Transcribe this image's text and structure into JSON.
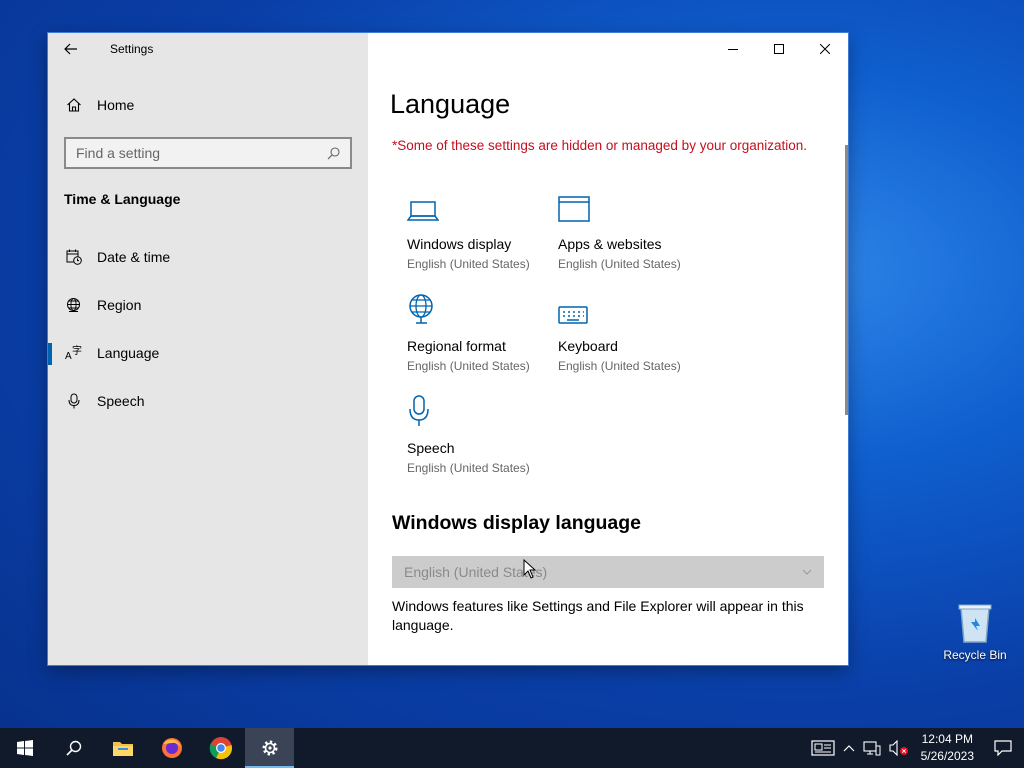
{
  "desktop": {
    "recycle_bin_label": "Recycle Bin"
  },
  "window": {
    "title": "Settings",
    "controls": [
      "minimize",
      "maximize",
      "close"
    ]
  },
  "sidebar": {
    "home_label": "Home",
    "search_placeholder": "Find a setting",
    "section_title": "Time & Language",
    "items": [
      {
        "label": "Date & time",
        "icon": "calendar-clock-icon",
        "active": false
      },
      {
        "label": "Region",
        "icon": "globe-icon",
        "active": false
      },
      {
        "label": "Language",
        "icon": "language-icon",
        "active": true
      },
      {
        "label": "Speech",
        "icon": "microphone-icon",
        "active": false
      }
    ]
  },
  "main": {
    "title": "Language",
    "warning": "*Some of these settings are hidden or managed by your organization.",
    "tiles": [
      {
        "label": "Windows display",
        "sub": "English (United States)",
        "icon": "laptop-icon"
      },
      {
        "label": "Apps & websites",
        "sub": "English (United States)",
        "icon": "window-icon"
      },
      {
        "label": "Regional format",
        "sub": "English (United States)",
        "icon": "globe-settings-icon"
      },
      {
        "label": "Keyboard",
        "sub": "English (United States)",
        "icon": "keyboard-icon"
      },
      {
        "label": "Speech",
        "sub": "English (United States)",
        "icon": "microphone-icon"
      }
    ],
    "display_language_heading": "Windows display language",
    "display_language_value": "English (United States)",
    "display_language_desc": "Windows features like Settings and File Explorer will appear in this language."
  },
  "taskbar": {
    "apps": [
      "start",
      "search",
      "file-explorer",
      "firefox",
      "chrome",
      "settings"
    ],
    "active_app": "settings",
    "time": "12:04 PM",
    "date": "5/26/2023"
  },
  "colors": {
    "accent": "#0063b1",
    "warning": "#c50f1f",
    "sidebar_bg": "#e6e6e6",
    "taskbar_bg": "#101a2a"
  }
}
